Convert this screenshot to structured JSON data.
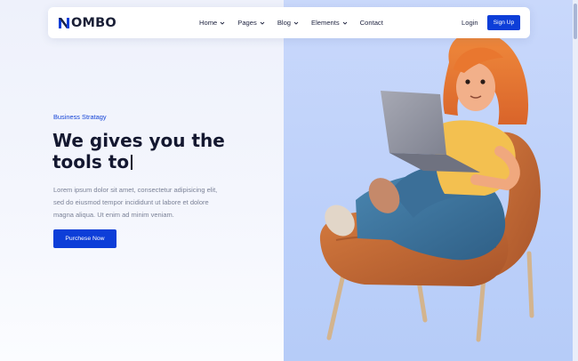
{
  "brand": {
    "name": "OMBO",
    "mark": "N-icon",
    "accent": "#0d3ed8"
  },
  "nav": {
    "items": [
      {
        "label": "Home",
        "has_dropdown": true
      },
      {
        "label": "Pages",
        "has_dropdown": true
      },
      {
        "label": "Blog",
        "has_dropdown": true
      },
      {
        "label": "Elements",
        "has_dropdown": true
      },
      {
        "label": "Contact",
        "has_dropdown": false
      }
    ],
    "login_label": "Login",
    "signup_label": "Sign Up"
  },
  "hero": {
    "eyebrow": "Business Stratagy",
    "headline_line1": "We gives you the",
    "headline_line2": "tools to",
    "body": "Lorem ipsum dolor sit amet, consectetur adipisicing elit, sed do eiusmod tempor incididunt ut labore et dolore magna aliqua. Ut enim ad minim veniam.",
    "cta_label": "Purchese Now"
  },
  "illustration": {
    "subject": "woman-with-laptop-in-armchair"
  },
  "colors": {
    "left_panel": "#eef1fb",
    "right_panel": "#c4d5fa",
    "heading": "#141830",
    "body_text": "#7b8297"
  }
}
